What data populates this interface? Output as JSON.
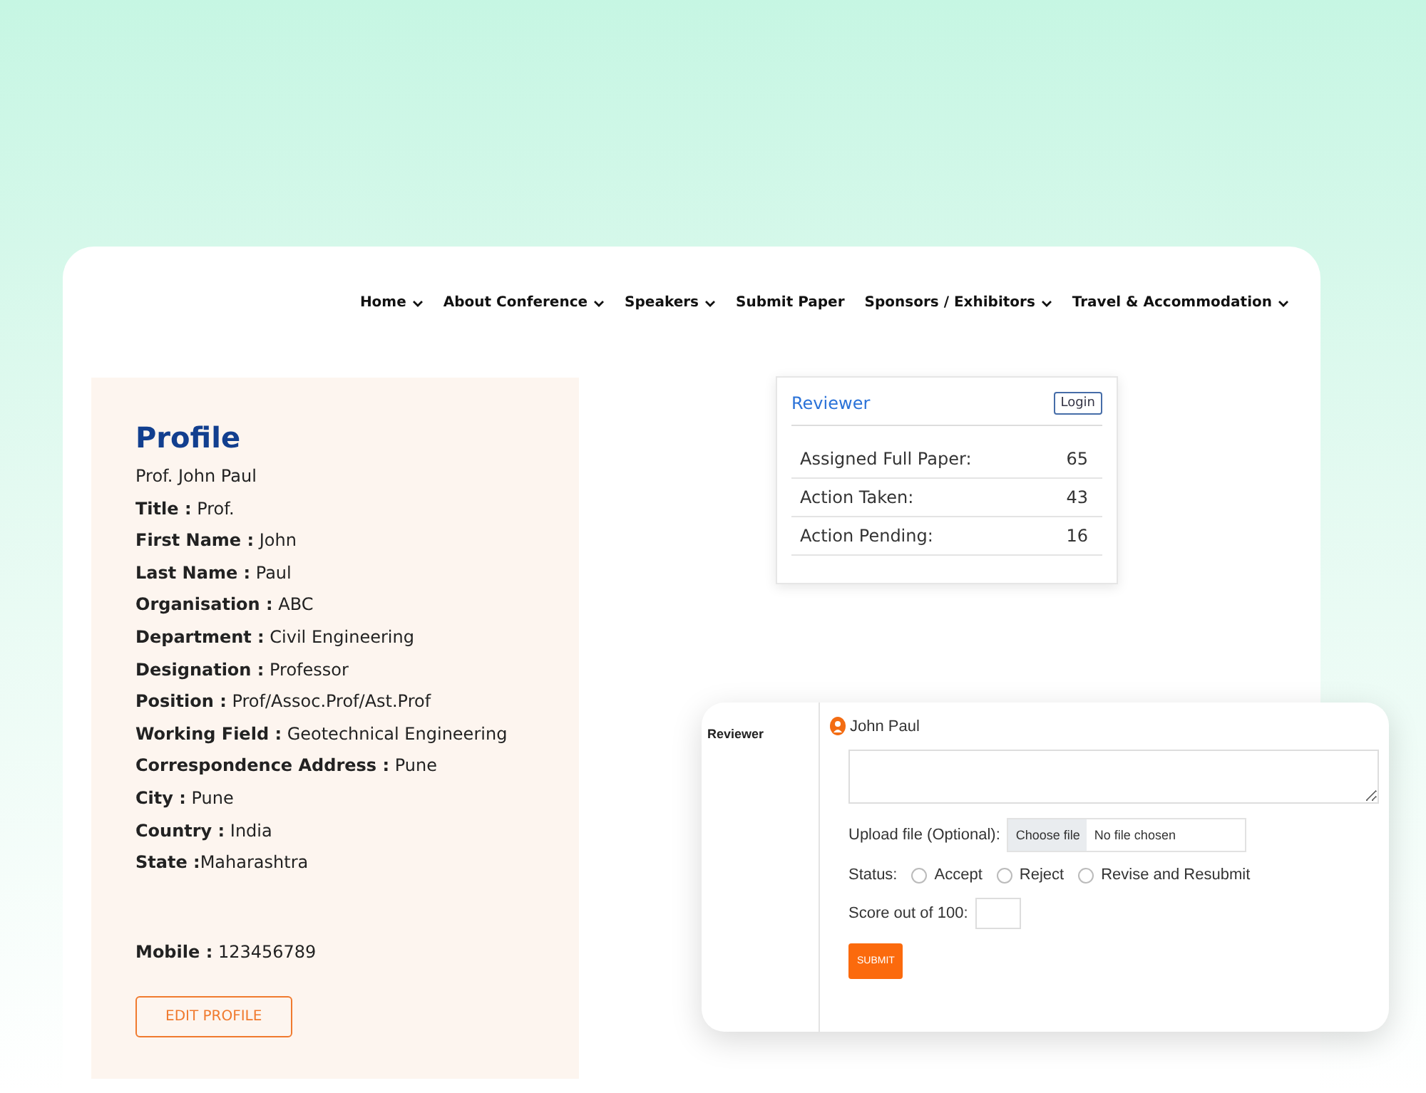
{
  "nav": [
    {
      "label": "Home",
      "dropdown": true
    },
    {
      "label": "About Conference",
      "dropdown": true
    },
    {
      "label": "Speakers",
      "dropdown": true
    },
    {
      "label": "Submit Paper",
      "dropdown": false
    },
    {
      "label": "Sponsors / Exhibitors",
      "dropdown": true
    },
    {
      "label": "Travel & Accommodation",
      "dropdown": true
    }
  ],
  "profile": {
    "heading": "Profile",
    "name": "Prof. John Paul",
    "fields": [
      "**Title :** Prof.",
      "**First Name :** John",
      "**Last Name :** Paul",
      "**Organisation :** ABC",
      "**Department :** Civil Engineering",
      "**Designation :** Professor",
      "**Position :** Prof/Assoc.Prof/Ast.Prof",
      "**Working Field :** Geotechnical Engineering",
      "**Correspondence Address :** Pune",
      "**City :** Pune",
      "**Country :** India",
      "**State :**Maharashtra"
    ],
    "mobile": "**Mobile :** 123456789",
    "button": "EDIT PROFILE"
  },
  "reviewer_card": {
    "title": "Reviewer",
    "login": "Login",
    "rows": [
      {
        "label": "Assigned Full Paper:",
        "value": "65"
      },
      {
        "label": "Action Taken:",
        "value": "43"
      },
      {
        "label": "Action Pending:",
        "value": "16"
      }
    ]
  },
  "review_form": {
    "side_label": "Reviewer",
    "user": "John Paul",
    "upload_label": "Upload file (Optional):",
    "choose_file": "Choose file",
    "file_status": "No file chosen",
    "status_label": "Status:",
    "options": [
      {
        "label": "Accept",
        "selected": false
      },
      {
        "label": "Reject",
        "selected": false
      },
      {
        "label": "Revise and Resubmit",
        "selected": false
      }
    ],
    "score_label": "Score out of 100:",
    "submit": "SUBMIT"
  }
}
